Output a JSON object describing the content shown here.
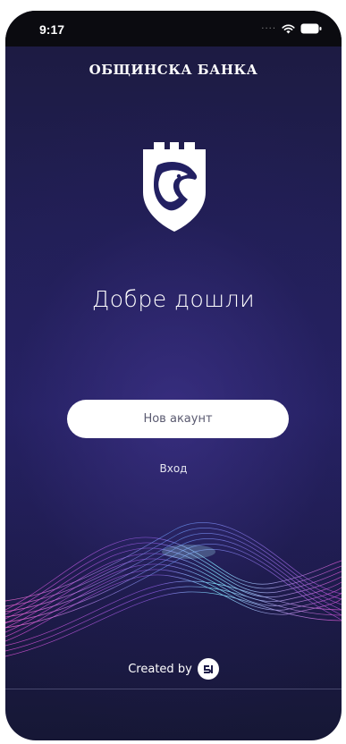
{
  "status_bar": {
    "time": "9:17",
    "icons": [
      "signal-dots-icon",
      "wifi-icon",
      "battery-icon"
    ]
  },
  "header": {
    "bank_name": "ОБЩИНСКА БАНКА"
  },
  "logo": {
    "icon": "shield-tower-bird-logo"
  },
  "welcome": {
    "title": "Добре дошли"
  },
  "actions": {
    "new_account_label": "Нов акаунт",
    "login_label": "Вход"
  },
  "footer": {
    "created_by_label": "Created by",
    "maker_icon": "maker-logo-icon"
  },
  "colors": {
    "background_top": "#1c1a3f",
    "background_mid": "#252263",
    "button_bg": "#ffffff",
    "button_text": "#5a5a70",
    "wave_pink": "#d04cc8",
    "wave_cyan": "#7fe6ff",
    "wave_purple": "#8a5ae0"
  }
}
